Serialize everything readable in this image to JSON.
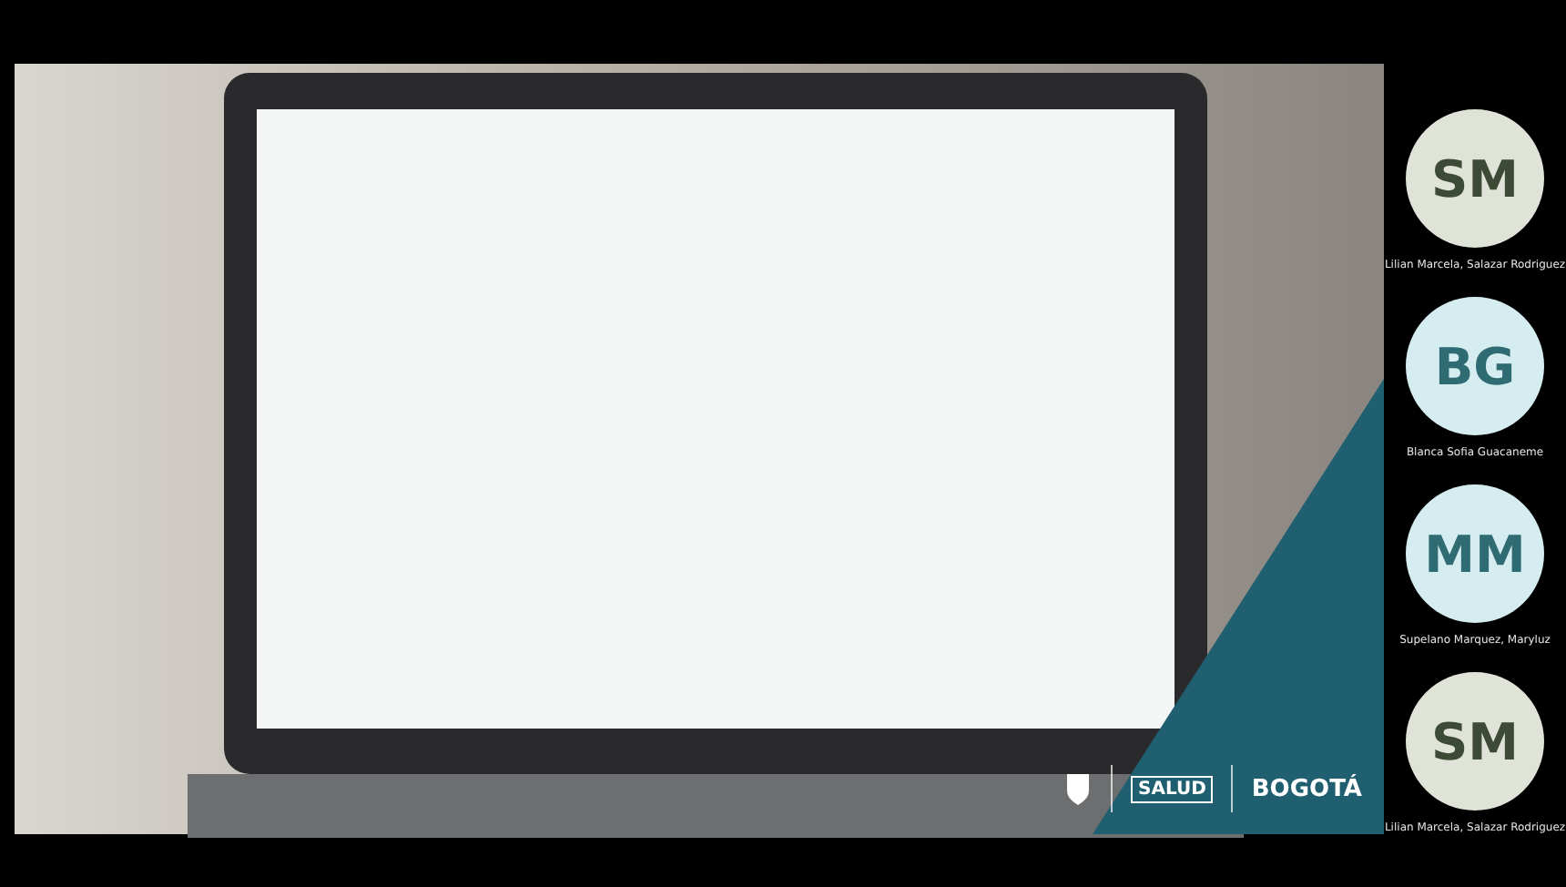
{
  "shared_slide": {
    "logos": [
      {
        "kind": "crest"
      },
      {
        "kind": "text",
        "text": "SALUD"
      },
      {
        "kind": "brand",
        "text": "BOGOTÁ"
      }
    ]
  },
  "participants": [
    {
      "initials": "SM",
      "name": "Lilian Marcela, Salazar Rodriguez",
      "color": "#dfe3d8"
    },
    {
      "initials": "BG",
      "name": "Blanca Sofia Guacaneme",
      "color": "#d5edf0"
    },
    {
      "initials": "MM",
      "name": "Supelano Marquez, Maryluz",
      "color": "#d5edf0"
    },
    {
      "initials": "SM",
      "name": "Lilian Marcela, Salazar Rodriguez",
      "color": "#dfe3d8"
    }
  ]
}
